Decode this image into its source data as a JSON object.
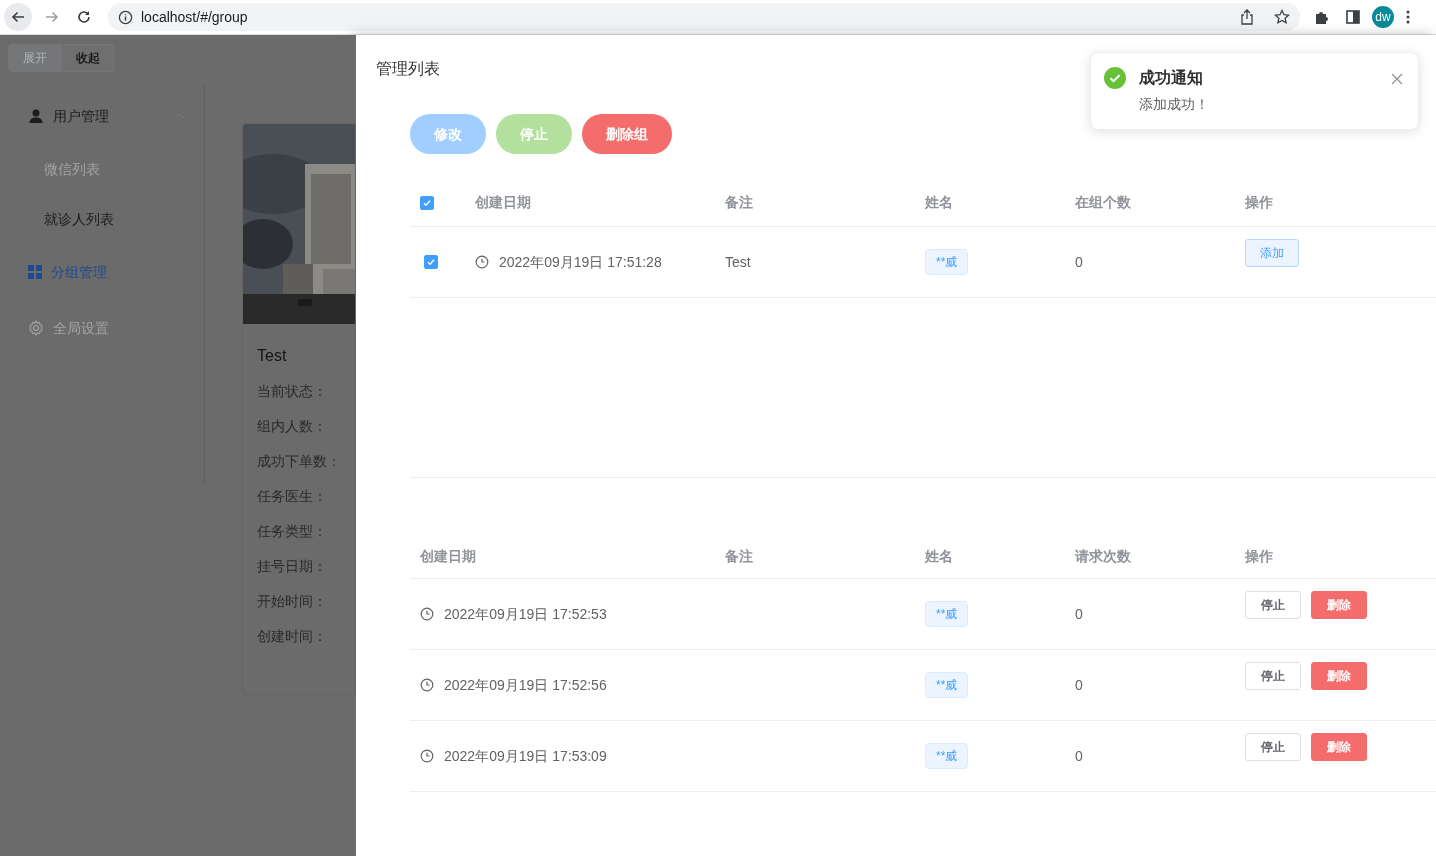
{
  "browser": {
    "url": "localhost/#/group",
    "avatar": "dw"
  },
  "sidebar": {
    "toggle": [
      {
        "label": "展开",
        "selected": false
      },
      {
        "label": "收起",
        "selected": true
      }
    ],
    "menu": [
      {
        "label": "用户管理",
        "selected": false,
        "disabled": false,
        "expanded": true,
        "children": [
          {
            "label": "微信列表",
            "selected": false,
            "disabled": true
          },
          {
            "label": "就诊人列表",
            "selected": false,
            "disabled": false
          }
        ]
      },
      {
        "label": "分组管理",
        "selected": true,
        "disabled": false
      },
      {
        "label": "全局设置",
        "selected": false,
        "disabled": true
      }
    ]
  },
  "card": {
    "kind": "picture",
    "title": "Test",
    "fields": [
      "当前状态：",
      "组内人数：",
      "成功下单数：",
      "任务医生：",
      "任务类型：",
      "挂号日期：",
      "开始时间：",
      "创建时间："
    ]
  },
  "drawer": {
    "title": "管理列表",
    "buttons": [
      {
        "label": "修改",
        "kind": "primary",
        "disabled": true
      },
      {
        "label": "停止",
        "kind": "success",
        "disabled": true
      },
      {
        "label": "删除组",
        "kind": "danger",
        "disabled": false
      }
    ],
    "group_table": {
      "all_checked": true,
      "columns": [
        "创建日期",
        "备注",
        "姓名",
        "在组个数",
        "操作"
      ],
      "rows": [
        {
          "checked": true,
          "date": "2022年09月19日 17:51:28",
          "note": "Test",
          "name": "**威",
          "count": "0",
          "action": "添加"
        }
      ]
    },
    "request_table": {
      "columns": [
        "创建日期",
        "备注",
        "姓名",
        "请求次数",
        "操作"
      ],
      "rows": [
        {
          "date": "2022年09月19日 17:52:53",
          "name": "**威",
          "count": "0",
          "actions": [
            {
              "label": "停止",
              "kind": "plain"
            },
            {
              "label": "删除",
              "kind": "danger"
            }
          ]
        },
        {
          "date": "2022年09月19日 17:52:56",
          "name": "**威",
          "count": "0",
          "actions": [
            {
              "label": "停止",
              "kind": "plain"
            },
            {
              "label": "删除",
              "kind": "danger"
            }
          ]
        },
        {
          "date": "2022年09月19日 17:53:09",
          "name": "**威",
          "count": "0",
          "actions": [
            {
              "label": "停止",
              "kind": "plain"
            },
            {
              "label": "删除",
              "kind": "danger"
            }
          ]
        }
      ]
    }
  },
  "toast": {
    "title": "成功通知",
    "message": "添加成功！"
  }
}
